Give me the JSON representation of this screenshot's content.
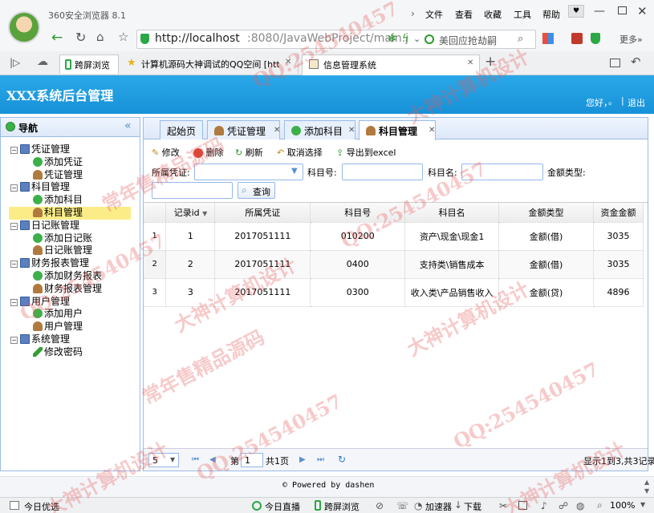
{
  "browser": {
    "title": "360安全浏览器 8.1",
    "menu": [
      "文件",
      "查看",
      "收藏",
      "工具",
      "帮助"
    ],
    "url_host": "http://localhost",
    "url_rest": ":8080/JavaWebProject/main.j",
    "search_text": "美回应抢劫嗣",
    "more_label": "更多»",
    "tabs": [
      "跨屏浏览",
      "计算机源码大神调试的QQ空间 [http:",
      "信息管理系统"
    ],
    "new_tab_symbol": "+"
  },
  "app": {
    "title": "XXX系统后台管理",
    "greeting": "您好，",
    "user_dot": "。",
    "separator": "|",
    "logout": "退出"
  },
  "sidebar": {
    "header": "导航",
    "collapse": "«",
    "groups": [
      {
        "label": "凭证管理",
        "children": [
          {
            "label": "添加凭证",
            "icon": "add"
          },
          {
            "label": "凭证管理",
            "icon": "user"
          }
        ]
      },
      {
        "label": "科目管理",
        "children": [
          {
            "label": "添加科目",
            "icon": "add"
          },
          {
            "label": "科目管理",
            "icon": "user",
            "selected": true
          }
        ]
      },
      {
        "label": "日记账管理",
        "children": [
          {
            "label": "添加日记账",
            "icon": "add"
          },
          {
            "label": "日记账管理",
            "icon": "user"
          }
        ]
      },
      {
        "label": "财务报表管理",
        "children": [
          {
            "label": "添加财务报表",
            "icon": "add"
          },
          {
            "label": "财务报表管理",
            "icon": "user"
          }
        ]
      },
      {
        "label": "用户管理",
        "children": [
          {
            "label": "添加用户",
            "icon": "add"
          },
          {
            "label": "用户管理",
            "icon": "user"
          }
        ]
      },
      {
        "label": "系统管理",
        "children": [
          {
            "label": "修改密码",
            "icon": "pen"
          }
        ]
      }
    ]
  },
  "tabs": [
    {
      "label": "起始页",
      "closable": false
    },
    {
      "label": "凭证管理",
      "closable": true
    },
    {
      "label": "添加科目",
      "closable": true
    },
    {
      "label": "科目管理",
      "closable": true,
      "active": true
    }
  ],
  "toolbar": {
    "edit": "修改",
    "delete": "删除",
    "refresh": "刷新",
    "cancel": "取消选择",
    "export": "导出到excel"
  },
  "search": {
    "voucher_label": "所属凭证:",
    "voucher_value": "",
    "subject_no_label": "科目号:",
    "subject_name_label": "科目名:",
    "amount_type_label": "金额类型:",
    "query_button": "查询"
  },
  "grid": {
    "columns": [
      "记录id",
      "所属凭证",
      "科目号",
      "科目名",
      "金额类型",
      "资金金额"
    ],
    "rows": [
      {
        "rownum": "1",
        "id": "1",
        "voucher": "2017051111",
        "subject_no": "010200",
        "subject_name": "资产\\现金\\现金1",
        "amount_type": "金额(借)",
        "amount": "3035"
      },
      {
        "rownum": "2",
        "id": "2",
        "voucher": "2017051111",
        "subject_no": "0400",
        "subject_name": "支持类\\销售成本",
        "amount_type": "金额(借)",
        "amount": "3035"
      },
      {
        "rownum": "3",
        "id": "3",
        "voucher": "2017051111",
        "subject_no": "0300",
        "subject_name": "收入类\\产品销售收入",
        "amount_type": "金额(贷)",
        "amount": "4896"
      }
    ]
  },
  "pager": {
    "page_size": "5",
    "page_label": "第",
    "page_value": "1",
    "total_pages": "共1页",
    "summary": "显示1到3,共3记录"
  },
  "footer": {
    "text": "© Powered by dashen"
  },
  "statusbar": {
    "left": "今日优选",
    "items": [
      "今日直播",
      "跨屏浏览",
      "加速器",
      "下载"
    ],
    "zoom": "100%"
  },
  "watermark": {
    "lines": [
      "QQ:254540457",
      "大神计算机设计",
      "常年售精品源码"
    ]
  }
}
